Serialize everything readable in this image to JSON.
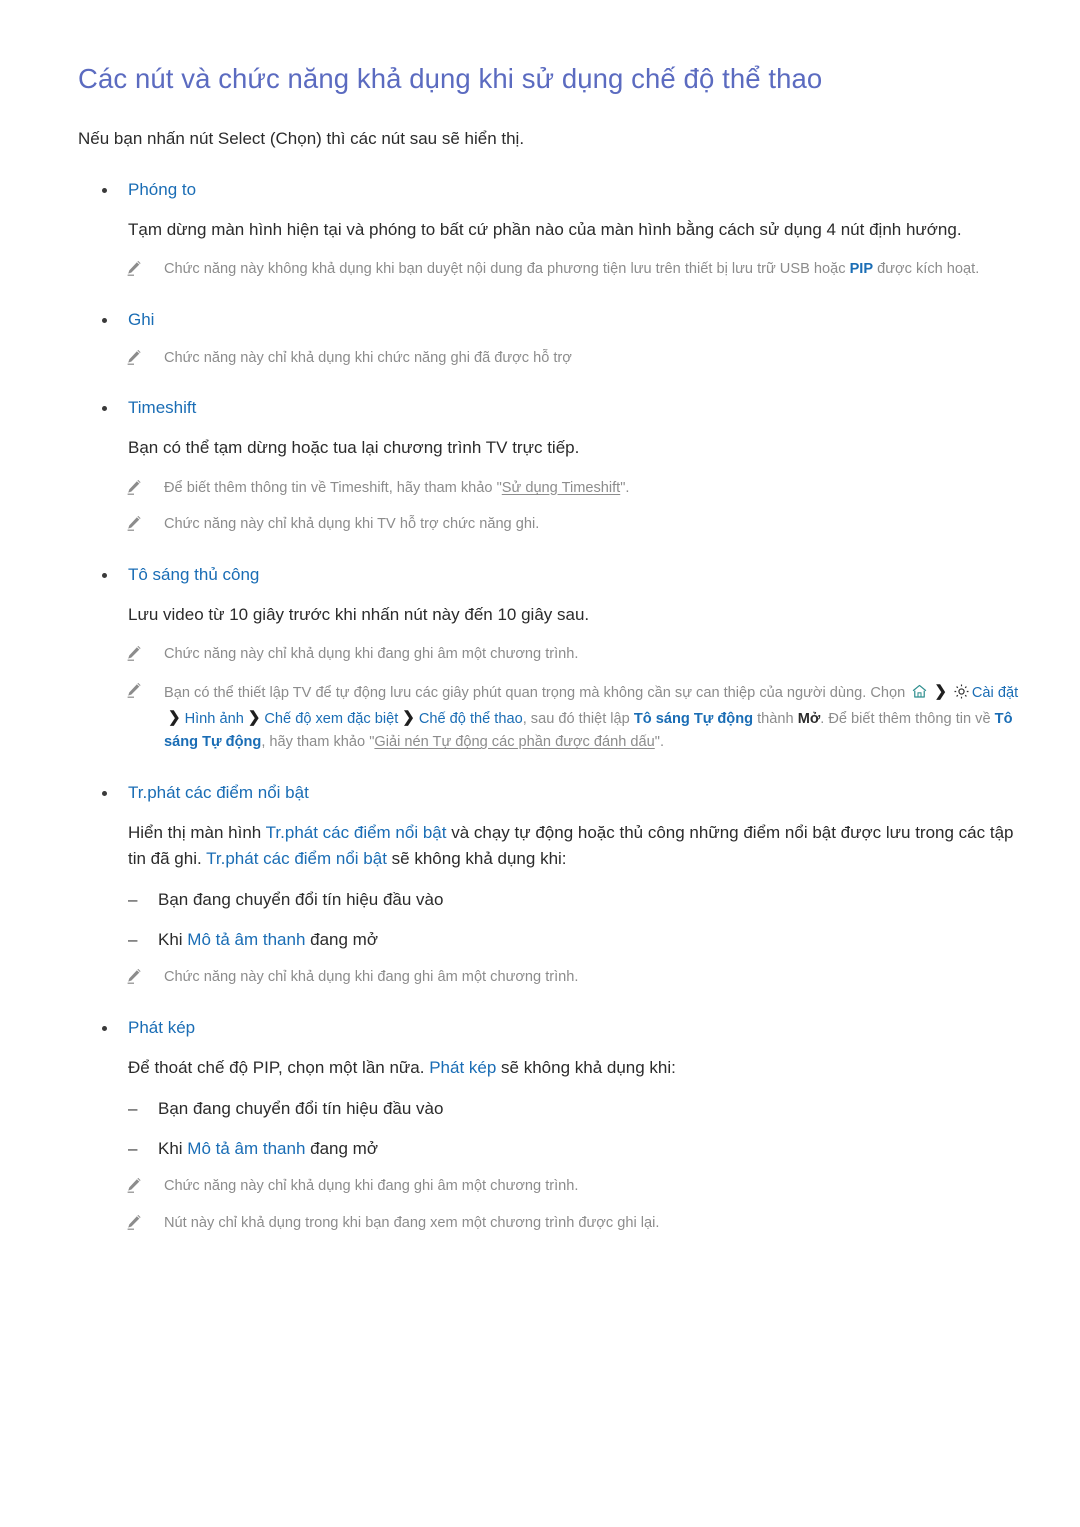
{
  "document": {
    "title": "Các nút và chức năng khả dụng khi sử dụng chế độ thể thao",
    "intro": "Nếu bạn nhấn nút Select (Chọn) thì các nút sau sẽ hiển thị."
  },
  "sections": {
    "zoom": {
      "heading": "Phóng to",
      "body": "Tạm dừng màn hình hiện tại và phóng to bất cứ phần nào của màn hình bằng cách sử dụng 4 nút định hướng.",
      "note1_before": "Chức năng này không khả dụng khi bạn duyệt nội dung đa phương tiện lưu trên thiết bị lưu trữ USB hoặc ",
      "note1_pip": "PIP",
      "note1_after": " được kích hoạt."
    },
    "record": {
      "heading": "Ghi",
      "note1": "Chức năng này chỉ khả dụng khi chức năng ghi đã được hỗ trợ"
    },
    "timeshift": {
      "heading": "Timeshift",
      "body": "Bạn có thể tạm dừng hoặc tua lại chương trình TV trực tiếp.",
      "note1_before": "Để biết thêm thông tin về Timeshift, hãy tham khảo \"",
      "note1_link": "Sử dụng Timeshift",
      "note1_after": "\".",
      "note2": "Chức năng này chỉ khả dụng khi TV hỗ trợ chức năng ghi."
    },
    "manual_highlight": {
      "heading": "Tô sáng thủ công",
      "body": "Lưu video từ 10 giây trước khi nhấn nút này đến 10 giây sau.",
      "note1": "Chức năng này chỉ khả dụng khi đang ghi âm một chương trình.",
      "note2_p1": "Bạn có thể thiết lập TV để tự động lưu các giây phút quan trọng mà không cần sự can thiệp của người dùng. Chọn ",
      "note2_menu": [
        "Cài đặt",
        "Hình ảnh",
        "Chế độ xem đặc biệt",
        "Chế độ thể thao"
      ],
      "note2_p2": ", sau đó thiệt lập ",
      "note2_term1": "Tô sáng Tự động",
      "note2_p3": " thành ",
      "note2_term2": "Mở",
      "note2_p4": ". Để biết thêm thông tin về ",
      "note2_term3": "Tô sáng Tự động",
      "note2_p5": ", hãy tham khảo \"",
      "note2_link": "Giải nén Tự động các phần được đánh dấu",
      "note2_p6": "\"."
    },
    "highlight_player": {
      "heading": "Tr.phát các điểm nổi bật",
      "body_p1": "Hiển thị màn hình ",
      "body_term1": "Tr.phát các điểm nổi bật",
      "body_p2": " và chạy tự động hoặc thủ công những điểm nổi bật được lưu trong các tập tin đã ghi. ",
      "body_term2": "Tr.phát các điểm nổi bật",
      "body_p3": " sẽ không khả dụng khi:",
      "item1": "Bạn đang chuyển đổi tín hiệu đầu vào",
      "item2_p1": "Khi ",
      "item2_term": "Mô tả âm thanh",
      "item2_p2": " đang mở",
      "note1": "Chức năng này chỉ khả dụng khi đang ghi âm một chương trình."
    },
    "dual_play": {
      "heading": "Phát kép",
      "body_p1": "Để thoát chế độ PIP, chọn một lần nữa. ",
      "body_term": "Phát kép",
      "body_p2": " sẽ không khả dụng khi:",
      "item1": "Bạn đang chuyển đổi tín hiệu đầu vào",
      "item2_p1": "Khi ",
      "item2_term": "Mô tả âm thanh",
      "item2_p2": " đang mở",
      "note1": "Chức năng này chỉ khả dụng khi đang ghi âm một chương trình.",
      "note2": "Nút này chỉ khả dụng trong khi bạn đang xem một chương trình được ghi lại."
    }
  },
  "colors": {
    "title": "#5b6bc0",
    "link_blue": "#1a6db5",
    "body_text": "#2b2b2b",
    "note_text": "#8c8c8c",
    "home_icon": "#2f8f8f"
  }
}
